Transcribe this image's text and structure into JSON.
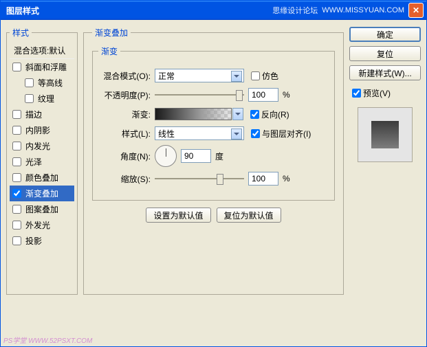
{
  "titlebar": {
    "title": "图层样式",
    "forum": "思缘设计论坛",
    "url": "WWW.MISSYUAN.COM"
  },
  "left": {
    "heading": "样式",
    "sub": "混合选项:默认",
    "items": [
      {
        "label": "斜面和浮雕",
        "checked": false,
        "indent": false
      },
      {
        "label": "等高线",
        "checked": false,
        "indent": true
      },
      {
        "label": "纹理",
        "checked": false,
        "indent": true
      },
      {
        "label": "描边",
        "checked": false,
        "indent": false
      },
      {
        "label": "内阴影",
        "checked": false,
        "indent": false
      },
      {
        "label": "内发光",
        "checked": false,
        "indent": false
      },
      {
        "label": "光泽",
        "checked": false,
        "indent": false
      },
      {
        "label": "颜色叠加",
        "checked": false,
        "indent": false
      },
      {
        "label": "渐变叠加",
        "checked": true,
        "indent": false,
        "selected": true
      },
      {
        "label": "图案叠加",
        "checked": false,
        "indent": false
      },
      {
        "label": "外发光",
        "checked": false,
        "indent": false
      },
      {
        "label": "投影",
        "checked": false,
        "indent": false
      }
    ]
  },
  "panel": {
    "title": "渐变叠加",
    "group": "渐变",
    "blend_label": "混合模式(O):",
    "blend_value": "正常",
    "dither_label": "仿色",
    "opacity_label": "不透明度(P):",
    "opacity_value": "100",
    "pct": "%",
    "grad_label": "渐变:",
    "reverse_label": "反向(R)",
    "style_label": "样式(L):",
    "style_value": "线性",
    "align_label": "与图层对齐(I)",
    "angle_label": "角度(N):",
    "angle_value": "90",
    "deg": "度",
    "scale_label": "缩放(S):",
    "scale_value": "100",
    "btn_default": "设置为默认值",
    "btn_reset": "复位为默认值"
  },
  "right": {
    "ok": "确定",
    "reset": "复位",
    "newstyle": "新建样式(W)...",
    "preview": "预览(V)"
  },
  "watermark": "PS学堂  WWW.52PSXT.COM"
}
